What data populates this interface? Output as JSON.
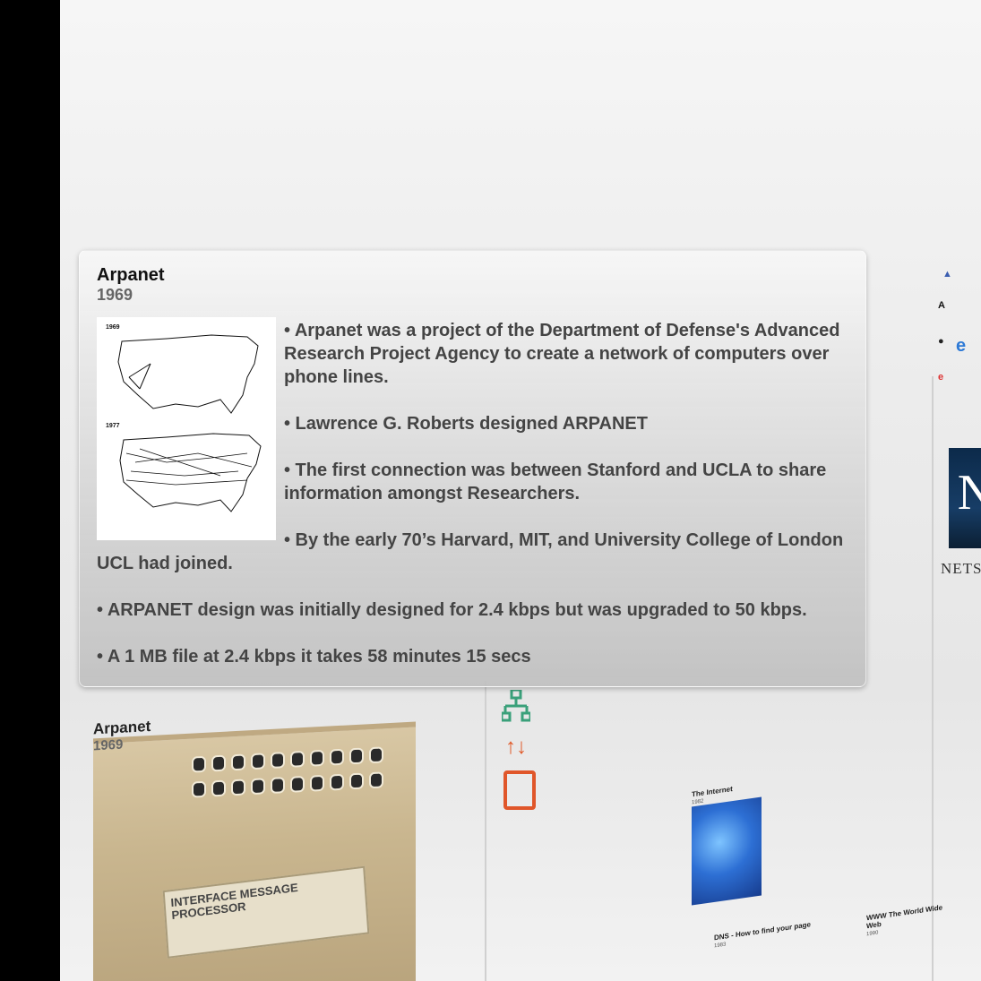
{
  "popup": {
    "title": "Arpanet",
    "year": "1969",
    "map_years": [
      "1969",
      "1977"
    ],
    "bullets": [
      "• Arpanet was a project of the Department of Defense's Advanced Research Project Agency to create a network of computers over phone lines.",
      "• Lawrence G. Roberts designed ARPANET",
      "• The first connection was between Stanford and UCLA to share information amongst Researchers.",
      "• By the early 70’s Harvard, MIT, and University College of London UCL had joined.",
      "• ARPANET design was initially designed for 2.4 kbps but was upgraded to 50 kbps.",
      "• A 1 MB file at 2.4 kbps it takes 58 minutes 15 secs"
    ]
  },
  "background": {
    "arpanet_card": {
      "title": "Arpanet",
      "year": "1969",
      "imp_label": "INTERFACE MESSAGE PROCESSOR"
    },
    "internet_card": {
      "title": "The Internet",
      "year": "1982"
    },
    "dns_card": {
      "title": "DNS - How to find your page",
      "year": "1983"
    },
    "www_card": {
      "title": "WWW The World Wide Web",
      "year": "1990"
    },
    "netscape_card": {
      "brand": "NETSCA"
    }
  },
  "colors": {
    "network_icon": "#3aa07a",
    "printer_icon": "#e0562a"
  }
}
